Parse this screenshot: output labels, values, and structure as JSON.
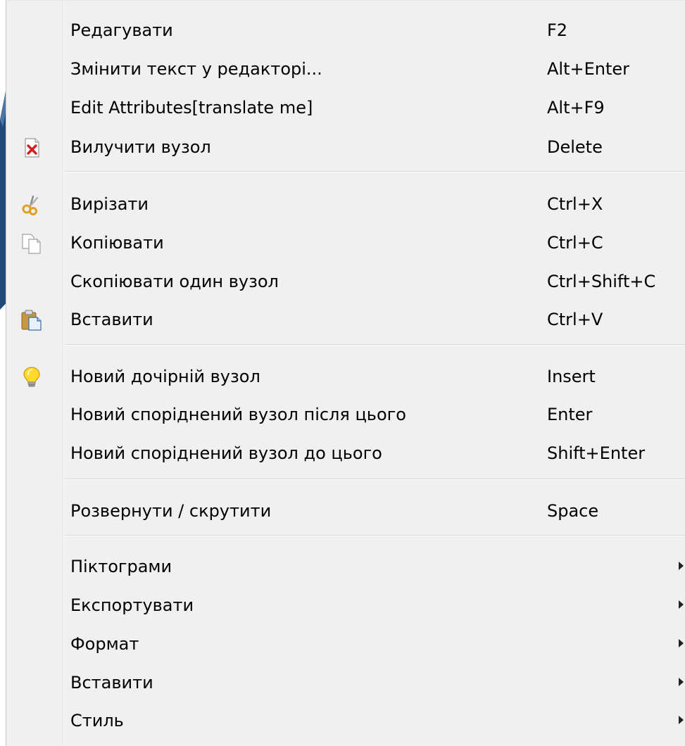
{
  "menu": {
    "items": [
      {
        "label": "Редагувати",
        "shortcut": "F2",
        "icon": ""
      },
      {
        "label": "Змінити текст у редакторі...",
        "shortcut": "Alt+Enter",
        "icon": ""
      },
      {
        "label": "Edit Attributes[translate me]",
        "shortcut": "Alt+F9",
        "icon": ""
      },
      {
        "label": "Вилучити вузол",
        "shortcut": "Delete",
        "icon": "delete-node-icon"
      },
      {
        "label": "Вирізати",
        "shortcut": "Ctrl+X",
        "icon": "scissors-icon"
      },
      {
        "label": "Копіювати",
        "shortcut": "Ctrl+C",
        "icon": "copy-icon"
      },
      {
        "label": "Скопіювати один вузол",
        "shortcut": "Ctrl+Shift+C",
        "icon": ""
      },
      {
        "label": "Вставити",
        "shortcut": "Ctrl+V",
        "icon": "paste-icon"
      },
      {
        "label": "Новий дочірній вузол",
        "shortcut": "Insert",
        "icon": "lightbulb-icon"
      },
      {
        "label": "Новий споріднений вузол після цього",
        "shortcut": "Enter",
        "icon": ""
      },
      {
        "label": "Новий споріднений вузол до цього",
        "shortcut": "Shift+Enter",
        "icon": ""
      },
      {
        "label": "Розвернути / скрутити",
        "shortcut": "Space",
        "icon": ""
      },
      {
        "label": "Піктограми",
        "submenu": true
      },
      {
        "label": "Експортувати",
        "submenu": true
      },
      {
        "label": "Формат",
        "submenu": true
      },
      {
        "label": "Вставити",
        "submenu": true
      },
      {
        "label": "Стиль",
        "submenu": true
      }
    ]
  },
  "colors": {
    "menu_background": "#f0f0f0",
    "separator": "#d6d6d6",
    "background_shape": "#1f4a78"
  }
}
